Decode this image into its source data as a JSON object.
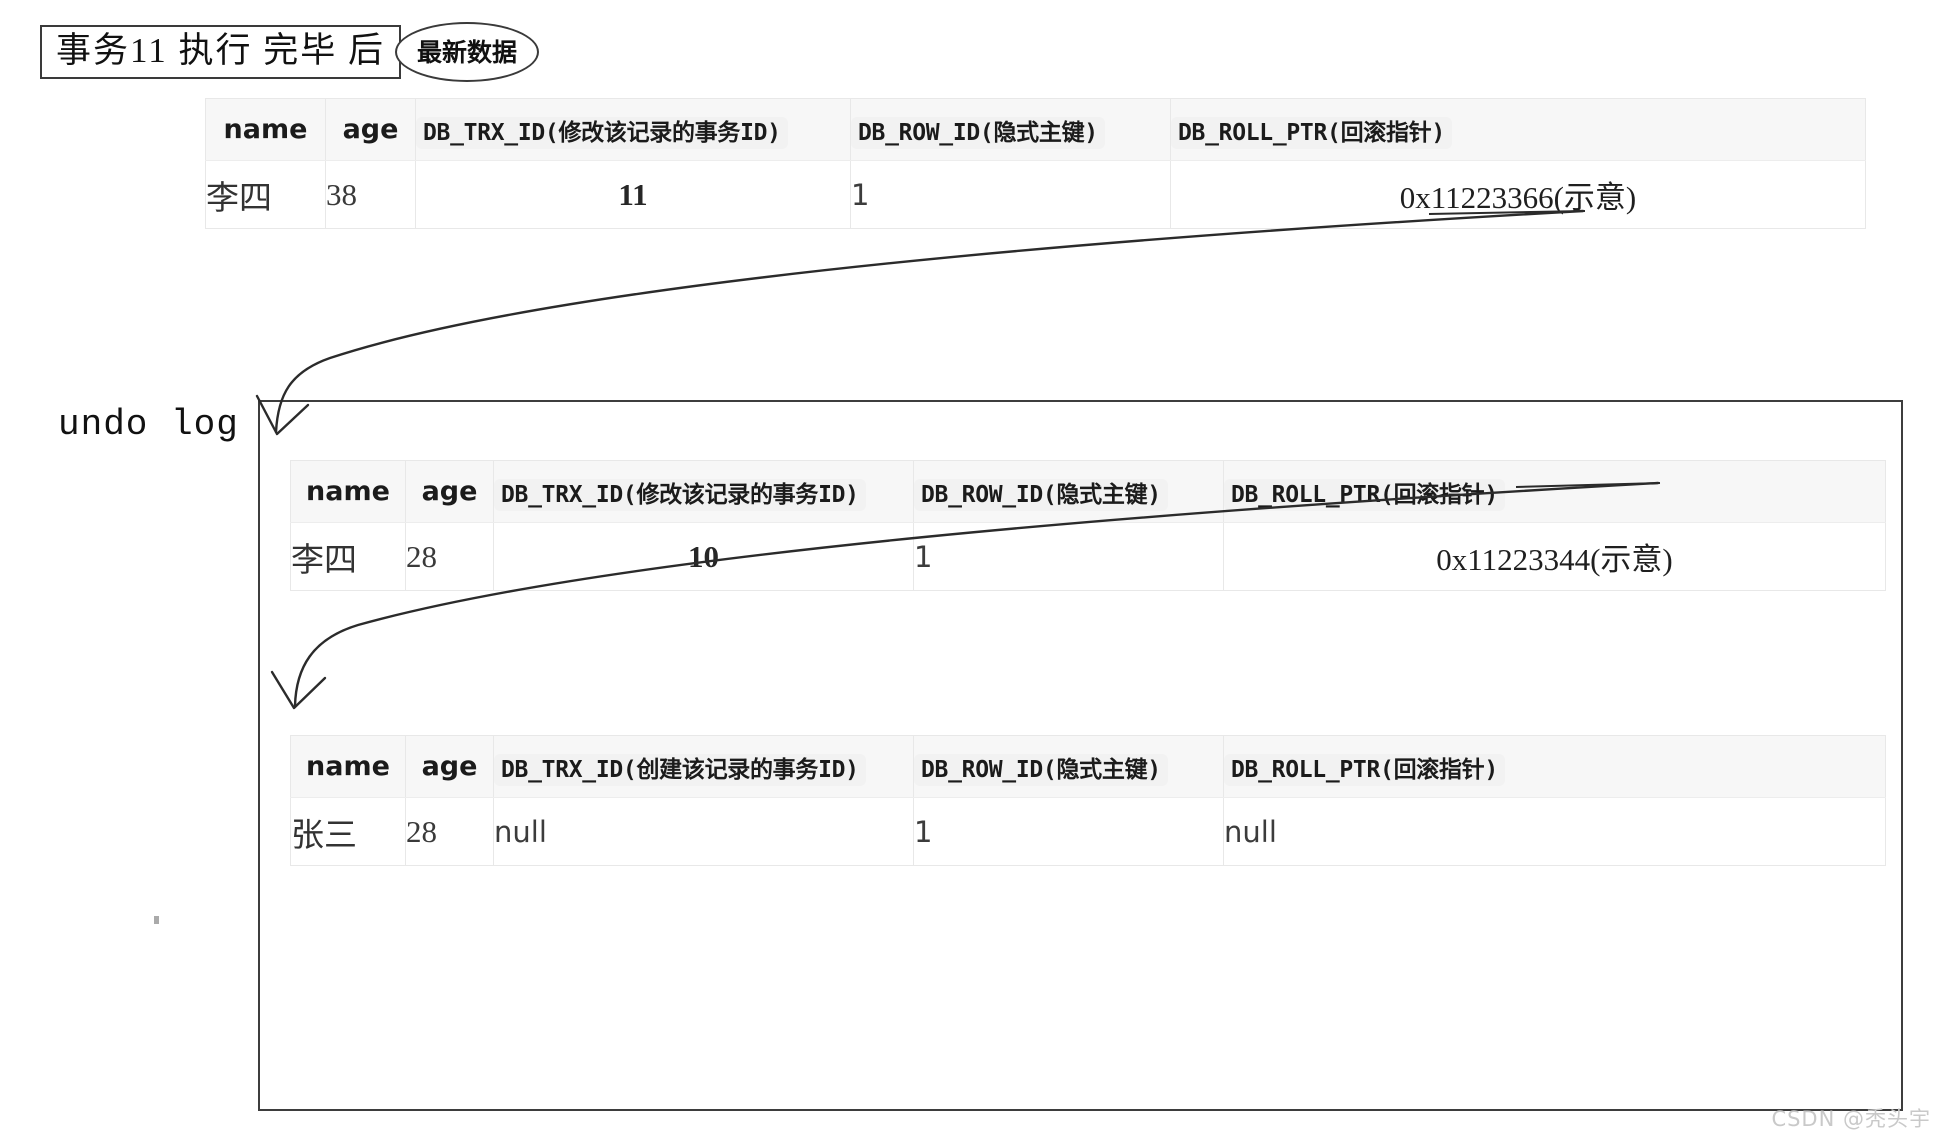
{
  "title": {
    "box_text": "事务11 执行 完毕 后",
    "badge_text": "最新数据"
  },
  "undo_log": {
    "label": "undo log"
  },
  "columns": {
    "name": "name",
    "age": "age",
    "trx_modify": "DB_TRX_ID(修改该记录的事务ID)",
    "trx_create": "DB_TRX_ID(创建该记录的事务ID)",
    "row_id": "DB_ROW_ID(隐式主键)",
    "roll_ptr": "DB_ROLL_PTR(回滚指针)"
  },
  "tables": [
    {
      "id": "latest",
      "headers": {
        "name": "name",
        "age": "age",
        "trx_id": "DB_TRX_ID(修改该记录的事务ID)",
        "row_id": "DB_ROW_ID(隐式主键)",
        "roll_ptr": "DB_ROLL_PTR(回滚指针)"
      },
      "row": {
        "name": "李四",
        "age": "38",
        "trx_id": "11",
        "row_id": "1",
        "roll_ptr": "0x11223366(示意)"
      }
    },
    {
      "id": "undo-1",
      "headers": {
        "name": "name",
        "age": "age",
        "trx_id": "DB_TRX_ID(修改该记录的事务ID)",
        "row_id": "DB_ROW_ID(隐式主键)",
        "roll_ptr": "DB_ROLL_PTR(回滚指针)"
      },
      "row": {
        "name": "李四",
        "age": "28",
        "trx_id": "10",
        "row_id": "1",
        "roll_ptr": "0x11223344(示意)"
      }
    },
    {
      "id": "undo-2",
      "headers": {
        "name": "name",
        "age": "age",
        "trx_id": "DB_TRX_ID(创建该记录的事务ID)",
        "row_id": "DB_ROW_ID(隐式主键)",
        "roll_ptr": "DB_ROLL_PTR(回滚指针)"
      },
      "row": {
        "name": "张三",
        "age": "28",
        "trx_id": "null",
        "row_id": "1",
        "roll_ptr": "null"
      }
    }
  ],
  "watermark": "CSDN @秃头宇",
  "colors": {
    "header_bg": "#f7f7f7",
    "chip_bg": "#f2f2f2",
    "grid_line": "#e8e8e8",
    "box_border": "#3d3d3d",
    "arrow": "#2b2b2b",
    "watermark": "#c9c9c9"
  }
}
